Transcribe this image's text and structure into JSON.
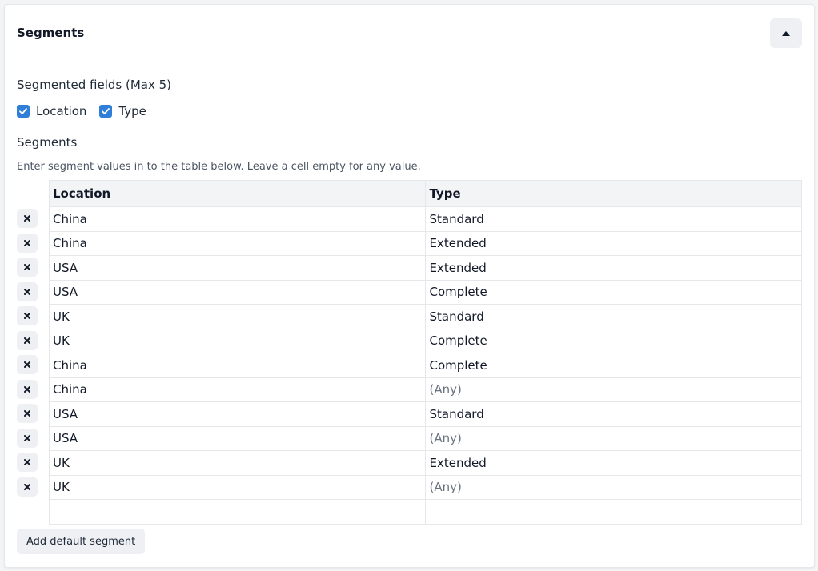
{
  "panel": {
    "title": "Segments"
  },
  "segmented_fields": {
    "label": "Segmented fields (Max 5)",
    "options": [
      {
        "label": "Location",
        "checked": true
      },
      {
        "label": "Type",
        "checked": true
      }
    ]
  },
  "segments": {
    "label": "Segments",
    "hint": "Enter segment values in to the table below. Leave a cell empty for any value.",
    "columns": [
      "Location",
      "Type"
    ],
    "empty_placeholder": "(Any)",
    "rows": [
      [
        "China",
        "Standard"
      ],
      [
        "China",
        "Extended"
      ],
      [
        "USA",
        "Extended"
      ],
      [
        "USA",
        "Complete"
      ],
      [
        "UK",
        "Standard"
      ],
      [
        "UK",
        "Complete"
      ],
      [
        "China",
        "Complete"
      ],
      [
        "China",
        "(Any)"
      ],
      [
        "USA",
        "Standard"
      ],
      [
        "USA",
        "(Any)"
      ],
      [
        "UK",
        "Extended"
      ],
      [
        "UK",
        "(Any)"
      ]
    ]
  },
  "add_default_label": "Add default segment",
  "colors": {
    "accent": "#2f7fd9",
    "button_bg": "#eef0f3",
    "border": "#e5e7eb",
    "muted": "#6b7280"
  },
  "icons": {
    "collapse": "chevron-up-icon",
    "remove": "close-icon",
    "checkbox": "check-icon"
  }
}
